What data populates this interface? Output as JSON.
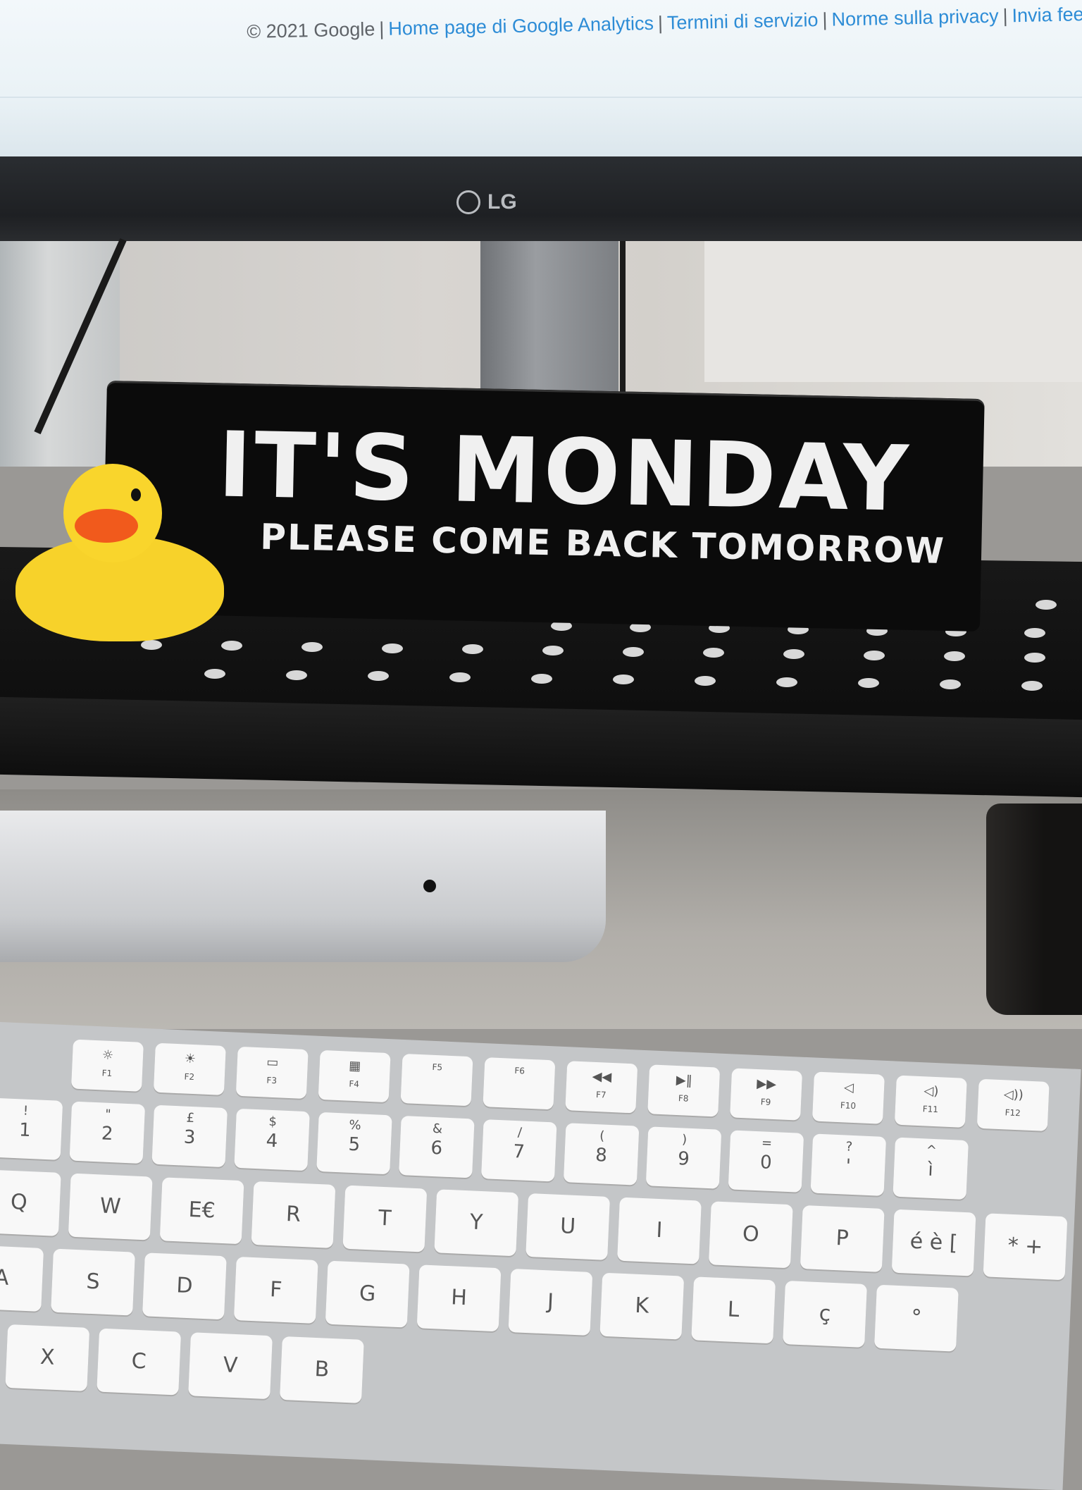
{
  "monitor": {
    "footer": {
      "copyright": "© 2021 Google",
      "links": [
        "Home page di Google Analytics",
        "Termini di servizio",
        "Norme sulla privacy",
        "Invia fee"
      ]
    },
    "brand": "LG"
  },
  "sign": {
    "title": "IT'S MONDAY",
    "subtitle": "PLEASE COME BACK TOMORROW"
  },
  "keyboard": {
    "function_row": [
      {
        "icon": "☼",
        "label": "F1"
      },
      {
        "icon": "☀",
        "label": "F2"
      },
      {
        "icon": "▭",
        "label": "F3"
      },
      {
        "icon": "▦",
        "label": "F4"
      },
      {
        "icon": "",
        "label": "F5"
      },
      {
        "icon": "",
        "label": "F6"
      },
      {
        "icon": "◀◀",
        "label": "F7"
      },
      {
        "icon": "▶‖",
        "label": "F8"
      },
      {
        "icon": "▶▶",
        "label": "F9"
      },
      {
        "icon": "◁",
        "label": "F10"
      },
      {
        "icon": "◁)",
        "label": "F11"
      },
      {
        "icon": "◁))",
        "label": "F12"
      }
    ],
    "number_row": [
      {
        "top": "!",
        "bot": "1"
      },
      {
        "top": "\"",
        "bot": "2"
      },
      {
        "top": "£",
        "bot": "3"
      },
      {
        "top": "$",
        "bot": "4"
      },
      {
        "top": "%",
        "bot": "5"
      },
      {
        "top": "&",
        "bot": "6"
      },
      {
        "top": "/",
        "bot": "7"
      },
      {
        "top": "(",
        "bot": "8"
      },
      {
        "top": ")",
        "bot": "9"
      },
      {
        "top": "=",
        "bot": "0"
      },
      {
        "top": "?",
        "bot": "'"
      },
      {
        "top": "^",
        "bot": "ì"
      }
    ],
    "qwerty_row": [
      "Q",
      "W",
      "E€",
      "R",
      "T",
      "Y",
      "U",
      "I",
      "O",
      "P",
      "é è [",
      "* +"
    ],
    "asdf_row": [
      "A",
      "S",
      "D",
      "F",
      "G",
      "H",
      "J",
      "K",
      "L",
      "ç",
      "°"
    ],
    "zxcv_row": [
      "X",
      "C",
      "V",
      "B"
    ]
  }
}
